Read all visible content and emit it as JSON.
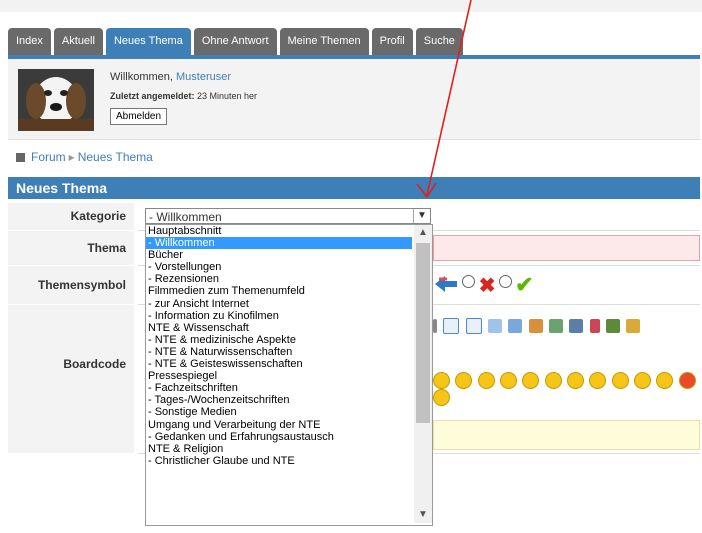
{
  "tabs": [
    {
      "label": "Index",
      "active": false
    },
    {
      "label": "Aktuell",
      "active": false
    },
    {
      "label": "Neues Thema",
      "active": true
    },
    {
      "label": "Ohne Antwort",
      "active": false
    },
    {
      "label": "Meine Themen",
      "active": false
    },
    {
      "label": "Profil",
      "active": false
    },
    {
      "label": "Suche",
      "active": false
    }
  ],
  "user": {
    "welcome_prefix": "Willkommen, ",
    "username": "Musteruser",
    "last_login_label": "Zuletzt angemeldet:",
    "last_login_value": " 23 Minuten her",
    "logout_label": "Abmelden"
  },
  "breadcrumb": {
    "forum": "Forum",
    "current": "Neues Thema"
  },
  "panel": {
    "title": "Neues Thema",
    "labels": {
      "kategorie": "Kategorie",
      "thema": "Thema",
      "themensymbol": "Themensymbol",
      "boardcode": "Boardcode"
    }
  },
  "select": {
    "selected": "- Willkommen",
    "options": [
      "Hauptabschnitt",
      "- Willkommen",
      "Bücher",
      "- Vorstellungen",
      "- Rezensionen",
      "Filmmedien zum Themenumfeld",
      "- zur Ansicht Internet",
      "- Information zu Kinofilmen",
      "NTE & Wissenschaft",
      "- NTE & medizinische Aspekte",
      "- NTE & Naturwissenschaften",
      "- NTE & Geisteswissenschaften",
      "Pressespiegel",
      "- Fachzeitschriften",
      "- Tages-/Wochenzeitschriften",
      "- Sonstige Medien",
      "Umgang und Verarbeitung der NTE",
      "- Gedanken und Erfahrungsaustausch",
      "NTE & Religion",
      "- Christlicher Glaube und NTE"
    ],
    "selected_index": 1
  },
  "colors": {
    "tab_bg": "#6a6a6a",
    "tab_active": "#3f7fb8",
    "link": "#3f7fb8",
    "highlight": "#3399ff",
    "arrow": "#e0201b"
  },
  "icons": {
    "chevron": "chevron-down-icon",
    "scroll_up": "chevron-up-icon",
    "scroll_down": "chevron-down-icon"
  }
}
